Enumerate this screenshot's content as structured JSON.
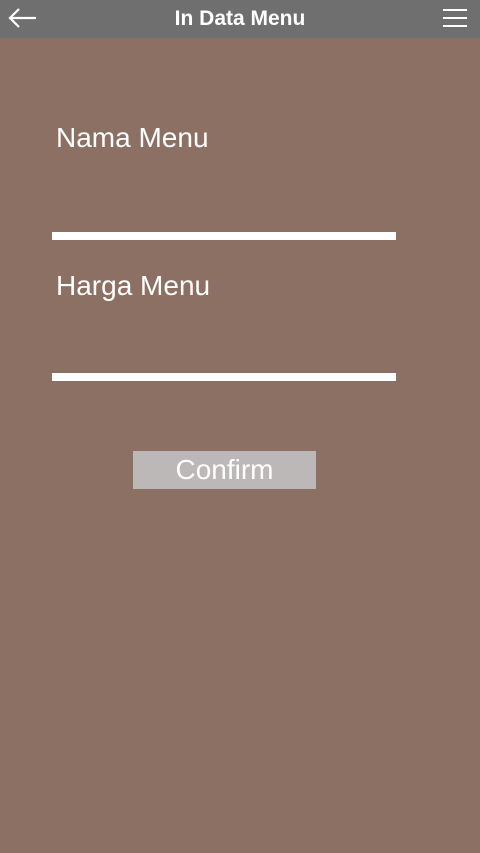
{
  "header": {
    "title": "In Data Menu",
    "back_icon": "arrow-left-icon",
    "menu_icon": "hamburger-menu-icon"
  },
  "form": {
    "name_label": "Nama Menu",
    "name_value": "",
    "price_label": "Harga Menu",
    "price_value": "",
    "confirm_label": "Confirm"
  },
  "colors": {
    "background": "#8c7064",
    "header": "#6f6f6f",
    "button": "#bdb8b8",
    "text": "#ffffff"
  }
}
